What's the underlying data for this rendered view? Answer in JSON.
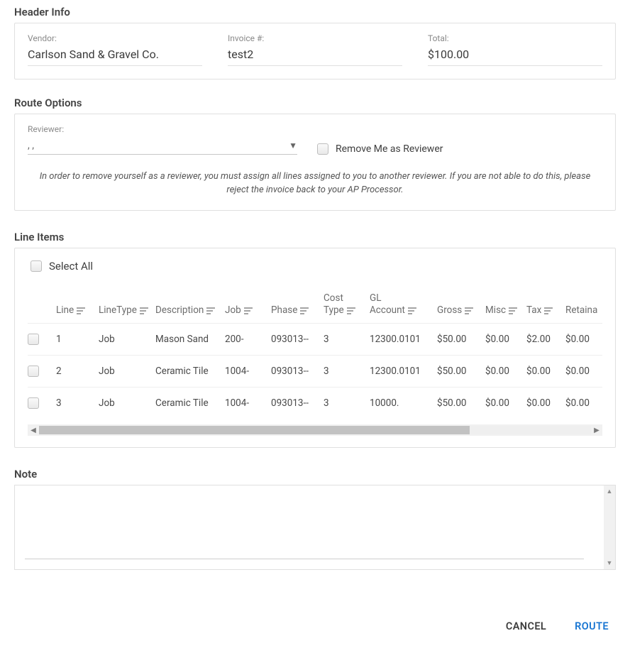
{
  "headerInfo": {
    "title": "Header Info",
    "vendorLabel": "Vendor:",
    "vendorValue": "Carlson Sand & Gravel Co.",
    "invoiceLabel": "Invoice #:",
    "invoiceValue": "test2",
    "totalLabel": "Total:",
    "totalValue": "$100.00"
  },
  "routeOptions": {
    "title": "Route Options",
    "reviewerLabel": "Reviewer:",
    "reviewerValue": ", ,",
    "removeMeLabel": "Remove Me as Reviewer",
    "helpText": "In order to remove yourself as a reviewer, you must assign all lines assigned to you to another reviewer. If you are not able to do this, please reject the invoice back to your AP Processor."
  },
  "lineItems": {
    "title": "Line Items",
    "selectAllLabel": "Select All",
    "columns": {
      "line": "Line",
      "lineType": "LineType",
      "description": "Description",
      "job": "Job",
      "phase": "Phase",
      "costType": "Cost\nType",
      "glAccount": "GL\nAccount",
      "gross": "Gross",
      "misc": "Misc",
      "tax": "Tax",
      "retainage": "Retaina"
    },
    "rows": [
      {
        "line": "1",
        "lineType": "Job",
        "description": "Mason Sand",
        "job": "200-",
        "phase": "093013--",
        "costType": "3",
        "glAccount": "12300.0101",
        "gross": "$50.00",
        "misc": "$0.00",
        "tax": "$2.00",
        "retainage": "$0.00"
      },
      {
        "line": "2",
        "lineType": "Job",
        "description": "Ceramic Tile",
        "job": "1004-",
        "phase": "093013--",
        "costType": "3",
        "glAccount": "12300.0101",
        "gross": "$50.00",
        "misc": "$0.00",
        "tax": "$0.00",
        "retainage": "$0.00"
      },
      {
        "line": "3",
        "lineType": "Job",
        "description": "Ceramic Tile",
        "job": "1004-",
        "phase": "093013--",
        "costType": "3",
        "glAccount": "10000.",
        "gross": "$50.00",
        "misc": "$0.00",
        "tax": "$0.00",
        "retainage": "$0.00"
      }
    ]
  },
  "note": {
    "title": "Note",
    "value": ""
  },
  "footer": {
    "cancel": "CANCEL",
    "route": "ROUTE"
  }
}
